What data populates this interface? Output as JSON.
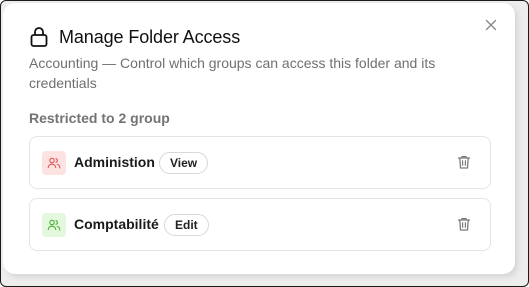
{
  "dialog": {
    "title": "Manage Folder Access",
    "description": "Accounting — Control which groups can access this folder and its credentials",
    "section_label": "Restricted to 2 group",
    "icons": {
      "header": "lock-icon",
      "close": "close-icon",
      "group": "users-icon",
      "remove": "trash-icon"
    }
  },
  "groups": [
    {
      "name": "Administion",
      "permission": "View",
      "avatar_bg": "#fde2e2",
      "avatar_color": "#e25757"
    },
    {
      "name": "Comptabilité",
      "permission": "Edit",
      "avatar_bg": "#e3f8dc",
      "avatar_color": "#4caf3a"
    }
  ]
}
